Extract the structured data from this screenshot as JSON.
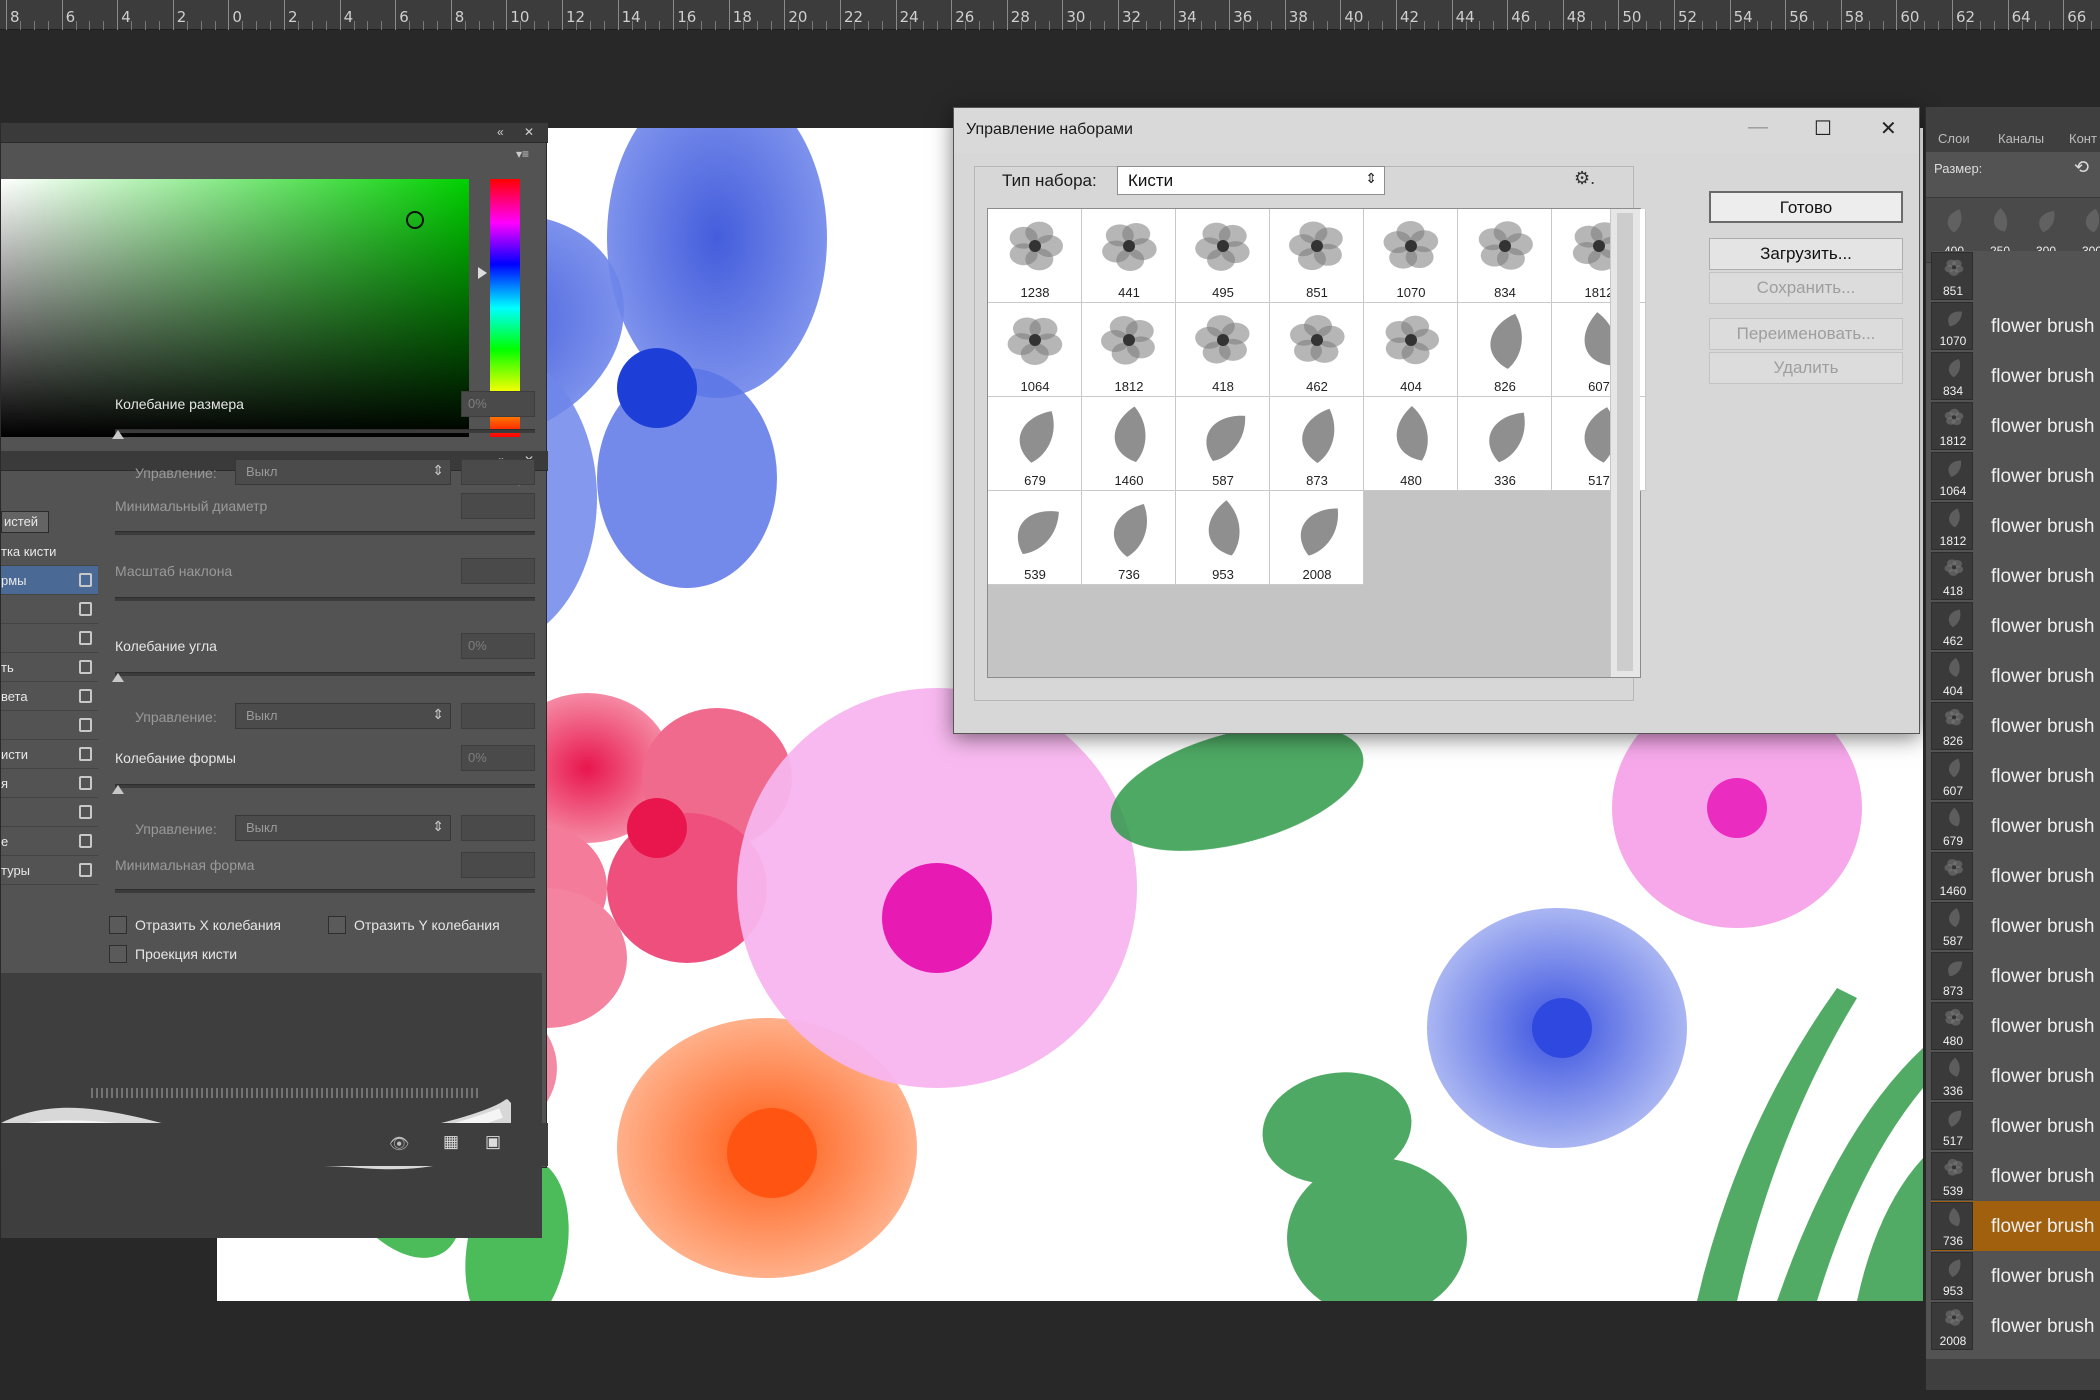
{
  "ruler": {
    "labels": [
      "8",
      "6",
      "4",
      "2",
      "0",
      "2",
      "4",
      "6",
      "8",
      "10",
      "12",
      "14",
      "16",
      "18",
      "20",
      "22",
      "24",
      "26",
      "28",
      "30",
      "32",
      "34",
      "36",
      "38",
      "40",
      "42",
      "44",
      "46",
      "48",
      "50",
      "52",
      "54",
      "56",
      "58",
      "60",
      "62",
      "64",
      "66"
    ]
  },
  "colors": {
    "ui_dark": "#282828",
    "panel": "#535353",
    "accent_selected": "#a0600d",
    "dialog_bg": "#d7d7d7"
  },
  "left_panel": {
    "sidelist": {
      "head": "истей",
      "items": [
        {
          "label": "тка кисти",
          "selected": false,
          "lock": false
        },
        {
          "label": "рмы",
          "selected": true,
          "lock": true
        },
        {
          "label": "",
          "selected": false,
          "lock": true
        },
        {
          "label": "",
          "selected": false,
          "lock": true
        },
        {
          "label": "ть",
          "selected": false,
          "lock": true
        },
        {
          "label": "вета",
          "selected": false,
          "lock": true
        },
        {
          "label": "",
          "selected": false,
          "lock": true
        },
        {
          "label": "исти",
          "selected": false,
          "lock": true
        },
        {
          "label": "я",
          "selected": false,
          "lock": true
        },
        {
          "label": "",
          "selected": false,
          "lock": true
        },
        {
          "label": "е",
          "selected": false,
          "lock": true
        },
        {
          "label": "туры",
          "selected": false,
          "lock": true
        }
      ]
    },
    "size_jitter": "Колебание размера",
    "size_jitter_pct": "0%",
    "control_label": "Управление:",
    "control_value": "Выкл",
    "min_diameter": "Минимальный диаметр",
    "tilt_scale": "Масштаб наклона",
    "angle_jitter": "Колебание угла",
    "angle_jitter_pct": "0%",
    "roundness_jitter": "Колебание формы",
    "roundness_jitter_pct": "0%",
    "min_roundness": "Минимальная форма",
    "flip_x": "Отразить X колебания",
    "flip_y": "Отразить Y колебания",
    "brush_projection": "Проекция кисти"
  },
  "dialog": {
    "title": "Управление наборами",
    "set_type_label": "Тип набора:",
    "set_type_value": "Кисти",
    "buttons": {
      "done": "Готово",
      "load": "Загрузить...",
      "save": "Сохранить...",
      "rename": "Переименовать...",
      "delete": "Удалить"
    },
    "brushes": [
      "1238",
      "441",
      "495",
      "851",
      "1070",
      "834",
      "1812",
      "1064",
      "1812",
      "418",
      "462",
      "404",
      "826",
      "607",
      "679",
      "1460",
      "587",
      "873",
      "480",
      "336",
      "517",
      "539",
      "736",
      "953",
      "2008"
    ]
  },
  "right_panel": {
    "tabs": [
      "Слои",
      "Каналы",
      "Конт"
    ],
    "size_label": "Размер:",
    "recent": [
      "400",
      "250",
      "300",
      "300"
    ],
    "items": [
      {
        "num": "851",
        "name": "",
        "selected": false
      },
      {
        "num": "1070",
        "name": "flower brush",
        "selected": false
      },
      {
        "num": "834",
        "name": "flower brush",
        "selected": false
      },
      {
        "num": "1812",
        "name": "flower brush",
        "selected": false
      },
      {
        "num": "1064",
        "name": "flower brush",
        "selected": false
      },
      {
        "num": "1812",
        "name": "flower brush",
        "selected": false
      },
      {
        "num": "418",
        "name": "flower brush",
        "selected": false
      },
      {
        "num": "462",
        "name": "flower brush",
        "selected": false
      },
      {
        "num": "404",
        "name": "flower brush",
        "selected": false
      },
      {
        "num": "826",
        "name": "flower brush",
        "selected": false
      },
      {
        "num": "607",
        "name": "flower brush",
        "selected": false
      },
      {
        "num": "679",
        "name": "flower brush",
        "selected": false
      },
      {
        "num": "1460",
        "name": "flower brush",
        "selected": false
      },
      {
        "num": "587",
        "name": "flower brush",
        "selected": false
      },
      {
        "num": "873",
        "name": "flower brush",
        "selected": false
      },
      {
        "num": "480",
        "name": "flower brush",
        "selected": false
      },
      {
        "num": "336",
        "name": "flower brush",
        "selected": false
      },
      {
        "num": "517",
        "name": "flower brush",
        "selected": false
      },
      {
        "num": "539",
        "name": "flower brush",
        "selected": false
      },
      {
        "num": "736",
        "name": "flower brush",
        "selected": true
      },
      {
        "num": "953",
        "name": "flower brush",
        "selected": false
      },
      {
        "num": "2008",
        "name": "flower brush",
        "selected": false
      }
    ]
  }
}
